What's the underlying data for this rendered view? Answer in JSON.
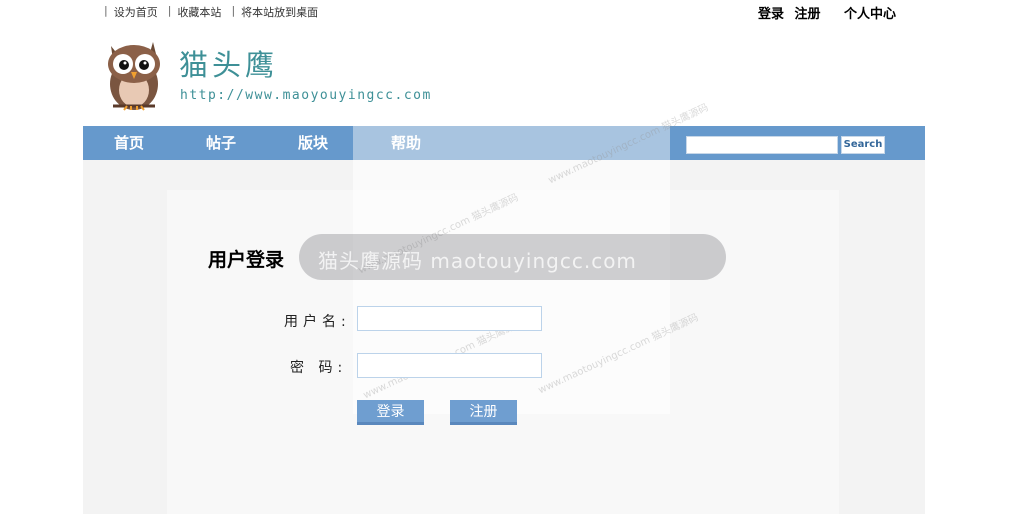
{
  "topbar": {
    "links": [
      "设为首页",
      "收藏本站",
      "将本站放到桌面"
    ],
    "login": "登录",
    "register": "注册",
    "user_center": "个人中心"
  },
  "header": {
    "site_name": "猫头鹰",
    "site_url": "http://www.maoyouyingcc.com"
  },
  "nav": {
    "items": [
      "首页",
      "帖子",
      "版块",
      "帮助"
    ],
    "search_button": "Search",
    "search_value": ""
  },
  "login": {
    "title": "用户登录",
    "username_label": "用户名:",
    "password_label": "密 码:",
    "username_value": "",
    "password_value": "",
    "login_button": "登录",
    "register_button": "注册"
  },
  "watermark": {
    "main": "猫头鹰源码 maotouyingcc.com",
    "small": "www.maotouyingcc.com 猫头鹰源码"
  },
  "colors": {
    "nav_bg": "#6699cc",
    "brand_teal": "#3e9097",
    "button_bg": "#6f9ed0"
  }
}
